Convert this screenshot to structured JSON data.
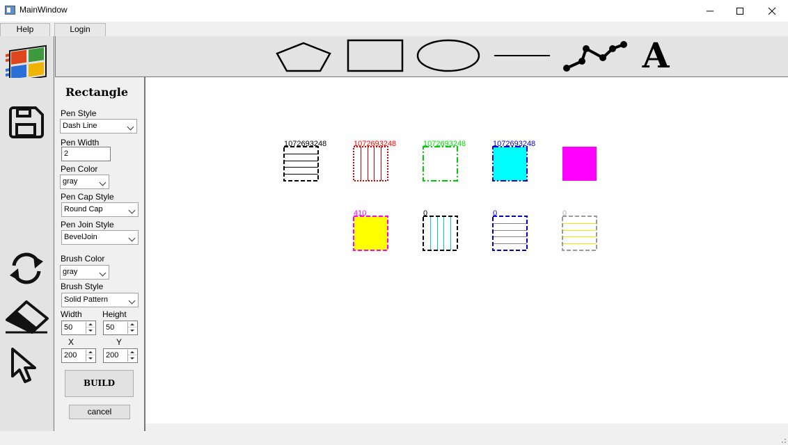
{
  "window": {
    "title": "MainWindow"
  },
  "menu": {
    "help": "Help",
    "login": "Login"
  },
  "toolbar_icons": [
    "pentagon-icon",
    "rectangle-icon",
    "ellipse-icon",
    "line-icon",
    "polyline-icon",
    "text-icon"
  ],
  "text_tool_glyph": "A",
  "side_icons": [
    "windows-logo-icon",
    "save-icon",
    "refresh-icon",
    "eraser-icon",
    "pointer-icon"
  ],
  "panel": {
    "title": "Rectangle",
    "pen_style_label": "Pen Style",
    "pen_style_value": "Dash Line",
    "pen_width_label": "Pen Width",
    "pen_width_value": "2",
    "pen_color_label": "Pen Color",
    "pen_color_value": "gray",
    "pen_cap_label": "Pen Cap Style",
    "pen_cap_value": "Round Cap",
    "pen_join_label": "Pen Join Style",
    "pen_join_value": "BevelJoin",
    "brush_color_label": "Brush Color",
    "brush_color_value": "gray",
    "brush_style_label": "Brush Style",
    "brush_style_value": "Solid Pattern",
    "width_label": "Width",
    "width_value": "50",
    "height_label": "Height",
    "height_value": "50",
    "x_label": "X",
    "x_value": "200",
    "y_label": "Y",
    "y_value": "200",
    "build_label": "BUILD",
    "cancel_label": "cancel"
  },
  "canvas_shapes": [
    {
      "label": "1072693248",
      "label_color": "#000000",
      "stroke": "#000000",
      "dash": "6,3",
      "fill": "#ffffff",
      "pattern": "hlines",
      "pattern_color": "#000000"
    },
    {
      "label": "1072693248",
      "label_color": "#ff0000",
      "stroke": "#cc0000",
      "dash": "2,2",
      "fill": "#ffffff",
      "pattern": "vlines",
      "pattern_color": "#cc0000"
    },
    {
      "label": "1072693248",
      "label_color": "#00e000",
      "stroke": "#00cc00",
      "dash": "8,3,2,3",
      "fill": "#ffffff",
      "pattern": "none",
      "pattern_color": ""
    },
    {
      "label": "1072693248",
      "label_color": "#0000cc",
      "stroke": "#0000cc",
      "dash": "8,3,2,3",
      "fill": "#00ffff",
      "pattern": "none",
      "pattern_color": ""
    },
    {
      "label": "",
      "label_color": "",
      "stroke": "none",
      "dash": "",
      "fill": "#ff00ff",
      "pattern": "none",
      "pattern_color": ""
    },
    {
      "label": "410",
      "label_color": "#ff00ff",
      "stroke": "#ff00ff",
      "dash": "6,3",
      "fill": "#ffff00",
      "pattern": "none",
      "pattern_color": ""
    },
    {
      "label": "0",
      "label_color": "#000000",
      "stroke": "#000000",
      "dash": "6,3",
      "fill": "#ffffff",
      "pattern": "vlines",
      "pattern_color": "#00cccc"
    },
    {
      "label": "0",
      "label_color": "#0000cc",
      "stroke": "#0000cc",
      "dash": "6,3",
      "fill": "#ffffff",
      "pattern": "hlines",
      "pattern_color": "#888888"
    },
    {
      "label": "0",
      "label_color": "#aaaaaa",
      "stroke": "#999999",
      "dash": "6,3",
      "fill": "#ffffff",
      "pattern": "hlines",
      "pattern_color": "#eeee00"
    }
  ]
}
